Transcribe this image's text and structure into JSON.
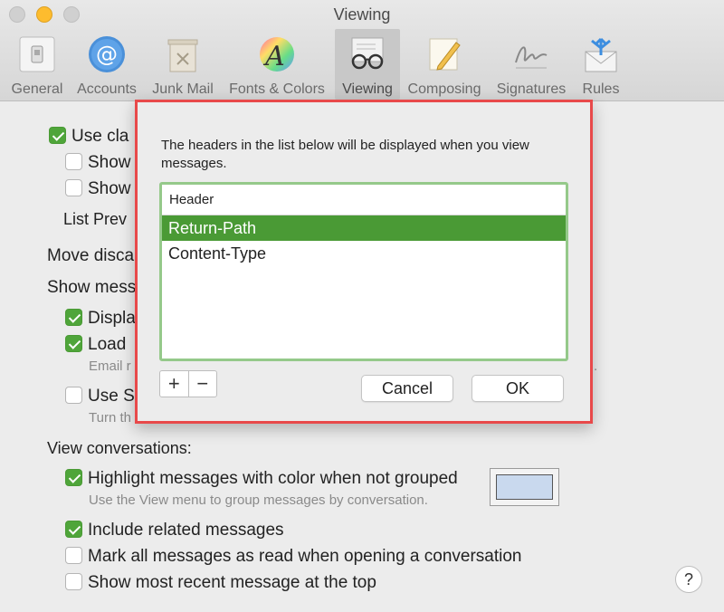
{
  "window": {
    "title": "Viewing"
  },
  "toolbar": {
    "items": [
      {
        "label": "General",
        "icon": "switch-icon"
      },
      {
        "label": "Accounts",
        "icon": "at-sign-icon"
      },
      {
        "label": "Junk Mail",
        "icon": "trash-icon"
      },
      {
        "label": "Fonts & Colors",
        "icon": "color-wheel-icon"
      },
      {
        "label": "Viewing",
        "icon": "glasses-icon",
        "selected": true
      },
      {
        "label": "Composing",
        "icon": "pencil-icon"
      },
      {
        "label": "Signatures",
        "icon": "signature-icon"
      },
      {
        "label": "Rules",
        "icon": "envelope-arrows-icon"
      }
    ]
  },
  "main": {
    "use_classic": "Use cla",
    "show1": "Show",
    "show2": "Show",
    "list_preview": "List Prev",
    "move_discarded": "Move disca",
    "show_message": "Show mess",
    "display": "Displa",
    "load": "Load",
    "email_note": "Email r",
    "use_s": "Use S",
    "turn_note": "Turn th",
    "stray_dot": ".",
    "view_conversations": "View conversations:",
    "highlight": "Highlight messages with color when not grouped",
    "highlight_note": "Use the View menu to group messages by conversation.",
    "include_related": "Include related messages",
    "mark_read": "Mark all messages as read when opening a conversation",
    "show_recent": "Show most recent message at the top",
    "help": "?",
    "highlight_color": "#c9d9ee"
  },
  "sheet": {
    "message": "The headers in the list below will be displayed when you view messages.",
    "column_header": "Header",
    "rows": [
      "Return-Path",
      "Content-Type"
    ],
    "add": "+",
    "remove": "−",
    "cancel": "Cancel",
    "ok": "OK",
    "accent_border": "#e8494a",
    "selection_color": "#4a9a35"
  }
}
